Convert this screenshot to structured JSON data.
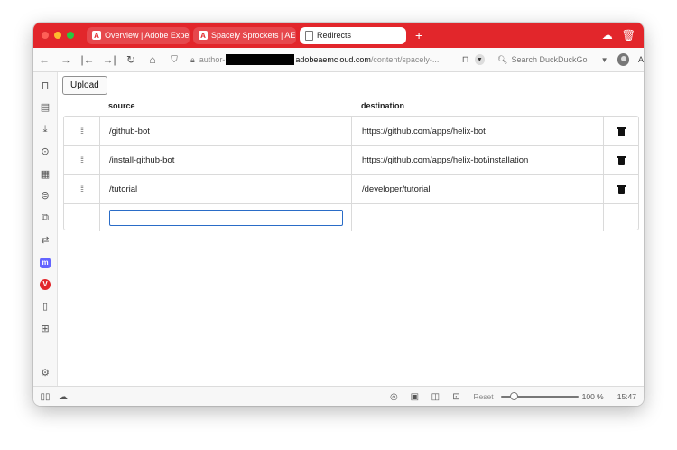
{
  "tabs": [
    {
      "label": "Overview | Adobe Experie",
      "icon": "adobe-icon",
      "active": false
    },
    {
      "label": "Spacely Sprockets | AEM S",
      "icon": "adobe-icon",
      "active": false
    },
    {
      "label": "Redirects",
      "icon": "document-icon",
      "active": true
    }
  ],
  "address": {
    "prefix": "author-",
    "host": "adobeaemcloud.com",
    "path": "/content/spacely-..."
  },
  "search": {
    "placeholder": "Search DuckDuckGo"
  },
  "toolbar": {
    "reader_label": "A"
  },
  "page": {
    "upload_label": "Upload",
    "source_header": "source",
    "destination_header": "destination",
    "rows": [
      {
        "source": "/github-bot",
        "destination": "https://github.com/apps/helix-bot"
      },
      {
        "source": "/install-github-bot",
        "destination": "https://github.com/apps/helix-bot/installation"
      },
      {
        "source": "/tutorial",
        "destination": "/developer/tutorial"
      }
    ],
    "new_source_value": ""
  },
  "status": {
    "reset_label": "Reset",
    "zoom": "100 %",
    "zoom_value": 100,
    "time": "15:47"
  },
  "colors": {
    "accent": "#e2262b",
    "focus": "#2a6cc7"
  }
}
